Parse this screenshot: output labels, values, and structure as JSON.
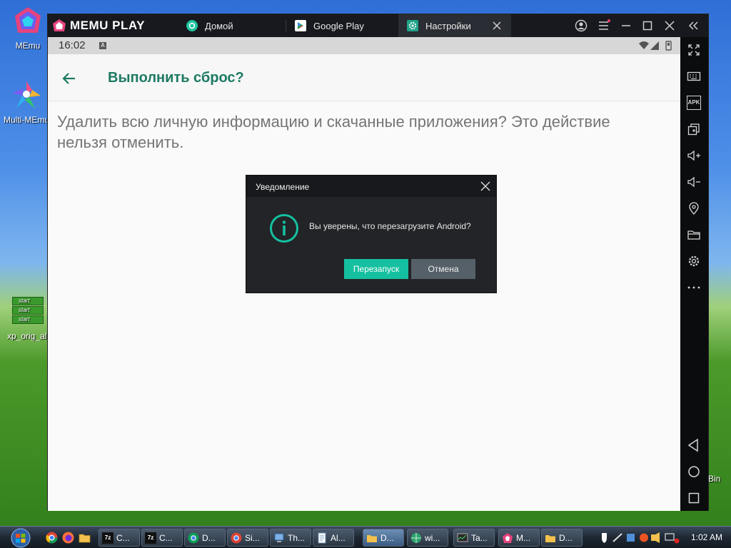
{
  "desktop": {
    "icons": [
      {
        "label": "MEmu"
      },
      {
        "label": "Multi-MEmu"
      },
      {
        "label": "xp_orig_all"
      }
    ],
    "start_tag": "start",
    "edge_text": "Bin"
  },
  "emulator": {
    "brand": "MEMU PLAY",
    "tabs": [
      {
        "label": "Домой",
        "icon": "home-app-icon"
      },
      {
        "label": "Google Play",
        "icon": "google-play-icon"
      },
      {
        "label": "Настройки",
        "icon": "settings-gear-icon"
      }
    ]
  },
  "android": {
    "status_time": "16:02",
    "status_badge": "A",
    "page_title": "Выполнить сброс?",
    "description": "Удалить всю личную информацию и скачанные приложения? Это действие нельзя отменить."
  },
  "dialog": {
    "title": "Уведомление",
    "message": "Вы уверены, что перезагрузите Android?",
    "confirm_label": "Перезапуск",
    "cancel_label": "Отмена"
  },
  "sidebar": {
    "buttons": [
      "fullscreen-icon",
      "keyboard-icon",
      "apk-icon",
      "multi-window-icon",
      "volume-up-icon",
      "volume-down-icon",
      "location-icon",
      "folder-icon",
      "settings-icon",
      "more-icon",
      "back-nav-icon",
      "home-nav-icon",
      "recents-nav-icon"
    ],
    "apk_label": "APK"
  },
  "taskbar": {
    "buttons": [
      {
        "label": "C..."
      },
      {
        "label": "C..."
      },
      {
        "label": "D..."
      },
      {
        "label": "Si..."
      },
      {
        "label": "Th..."
      },
      {
        "label": "Al..."
      },
      {
        "label": "D..."
      },
      {
        "label": "wi..."
      },
      {
        "label": "Ta..."
      },
      {
        "label": "M..."
      },
      {
        "label": "D..."
      }
    ],
    "clock": "1:02 AM"
  },
  "colors": {
    "accent": "#15c0a0",
    "title_green": "#1d7a63",
    "dialog_bg": "#222427"
  }
}
